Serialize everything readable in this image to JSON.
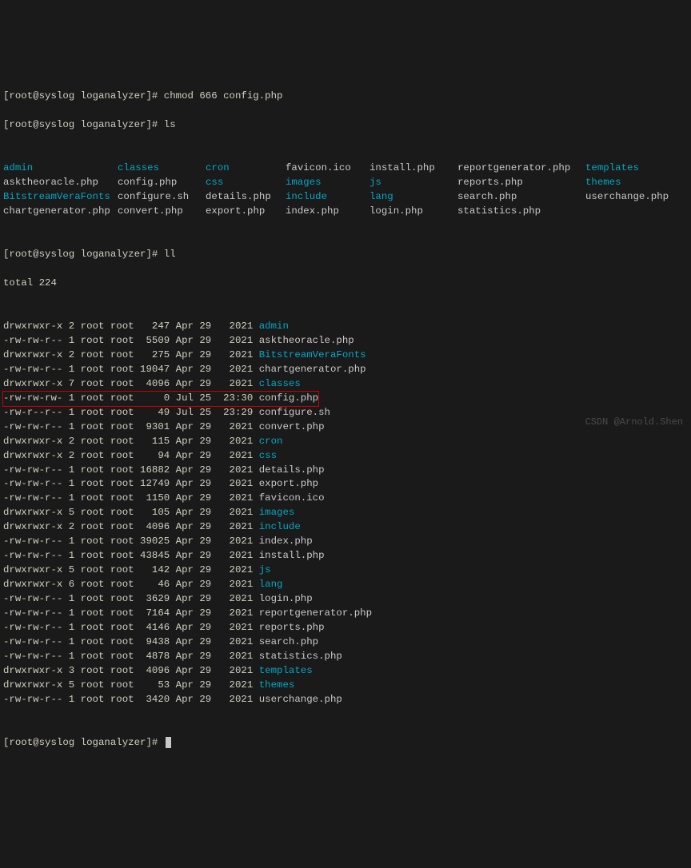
{
  "prompts": {
    "p1": "[root@syslog loganalyzer]# chmod 666 config.php",
    "p2": "[root@syslog loganalyzer]# ls",
    "p3": "[root@syslog loganalyzer]# ll",
    "p4": "[root@syslog loganalyzer]# "
  },
  "ls": {
    "row1": [
      "admin",
      "classes",
      "cron",
      "favicon.ico",
      "install.php",
      "reportgenerator.php",
      "templates"
    ],
    "row2": [
      "asktheoracle.php",
      "config.php",
      "css",
      "images",
      "js",
      "reports.php",
      "themes"
    ],
    "row3": [
      "BitstreamVeraFonts",
      "configure.sh",
      "details.php",
      "include",
      "lang",
      "search.php",
      "userchange.php"
    ],
    "row4": [
      "chartgenerator.php",
      "convert.php",
      "export.php",
      "index.php",
      "login.php",
      "statistics.php",
      ""
    ]
  },
  "ls_colors": {
    "row1": [
      "cyan",
      "cyan",
      "cyan",
      "gray",
      "gray",
      "gray",
      "cyan"
    ],
    "row2": [
      "gray",
      "gray",
      "cyan",
      "cyan",
      "cyan",
      "gray",
      "cyan"
    ],
    "row3": [
      "cyan",
      "gray",
      "gray",
      "cyan",
      "cyan",
      "gray",
      "gray"
    ],
    "row4": [
      "gray",
      "gray",
      "gray",
      "gray",
      "gray",
      "gray",
      "gray"
    ]
  },
  "total": "total 224",
  "ll": [
    {
      "perm": "drwxrwxr-x",
      "links": "2",
      "user": "root",
      "group": "root",
      "size": "247",
      "mon": "Apr",
      "day": "29",
      "time": "2021",
      "name": "admin",
      "cls": "cyan"
    },
    {
      "perm": "-rw-rw-r--",
      "links": "1",
      "user": "root",
      "group": "root",
      "size": "5509",
      "mon": "Apr",
      "day": "29",
      "time": "2021",
      "name": "asktheoracle.php",
      "cls": "gray"
    },
    {
      "perm": "drwxrwxr-x",
      "links": "2",
      "user": "root",
      "group": "root",
      "size": "275",
      "mon": "Apr",
      "day": "29",
      "time": "2021",
      "name": "BitstreamVeraFonts",
      "cls": "cyan"
    },
    {
      "perm": "-rw-rw-r--",
      "links": "1",
      "user": "root",
      "group": "root",
      "size": "19047",
      "mon": "Apr",
      "day": "29",
      "time": "2021",
      "name": "chartgenerator.php",
      "cls": "gray"
    },
    {
      "perm": "drwxrwxr-x",
      "links": "7",
      "user": "root",
      "group": "root",
      "size": "4096",
      "mon": "Apr",
      "day": "29",
      "time": "2021",
      "name": "classes",
      "cls": "cyan"
    },
    {
      "perm": "-rw-rw-rw-",
      "links": "1",
      "user": "root",
      "group": "root",
      "size": "0",
      "mon": "Jul",
      "day": "25",
      "time": "23:30",
      "name": "config.php",
      "cls": "gray",
      "highlight": true
    },
    {
      "perm": "-rw-r--r--",
      "links": "1",
      "user": "root",
      "group": "root",
      "size": "49",
      "mon": "Jul",
      "day": "25",
      "time": "23:29",
      "name": "configure.sh",
      "cls": "gray"
    },
    {
      "perm": "-rw-rw-r--",
      "links": "1",
      "user": "root",
      "group": "root",
      "size": "9301",
      "mon": "Apr",
      "day": "29",
      "time": "2021",
      "name": "convert.php",
      "cls": "gray"
    },
    {
      "perm": "drwxrwxr-x",
      "links": "2",
      "user": "root",
      "group": "root",
      "size": "115",
      "mon": "Apr",
      "day": "29",
      "time": "2021",
      "name": "cron",
      "cls": "cyan"
    },
    {
      "perm": "drwxrwxr-x",
      "links": "2",
      "user": "root",
      "group": "root",
      "size": "94",
      "mon": "Apr",
      "day": "29",
      "time": "2021",
      "name": "css",
      "cls": "cyan"
    },
    {
      "perm": "-rw-rw-r--",
      "links": "1",
      "user": "root",
      "group": "root",
      "size": "16882",
      "mon": "Apr",
      "day": "29",
      "time": "2021",
      "name": "details.php",
      "cls": "gray"
    },
    {
      "perm": "-rw-rw-r--",
      "links": "1",
      "user": "root",
      "group": "root",
      "size": "12749",
      "mon": "Apr",
      "day": "29",
      "time": "2021",
      "name": "export.php",
      "cls": "gray"
    },
    {
      "perm": "-rw-rw-r--",
      "links": "1",
      "user": "root",
      "group": "root",
      "size": "1150",
      "mon": "Apr",
      "day": "29",
      "time": "2021",
      "name": "favicon.ico",
      "cls": "gray"
    },
    {
      "perm": "drwxrwxr-x",
      "links": "5",
      "user": "root",
      "group": "root",
      "size": "105",
      "mon": "Apr",
      "day": "29",
      "time": "2021",
      "name": "images",
      "cls": "cyan"
    },
    {
      "perm": "drwxrwxr-x",
      "links": "2",
      "user": "root",
      "group": "root",
      "size": "4096",
      "mon": "Apr",
      "day": "29",
      "time": "2021",
      "name": "include",
      "cls": "cyan"
    },
    {
      "perm": "-rw-rw-r--",
      "links": "1",
      "user": "root",
      "group": "root",
      "size": "39025",
      "mon": "Apr",
      "day": "29",
      "time": "2021",
      "name": "index.php",
      "cls": "gray"
    },
    {
      "perm": "-rw-rw-r--",
      "links": "1",
      "user": "root",
      "group": "root",
      "size": "43845",
      "mon": "Apr",
      "day": "29",
      "time": "2021",
      "name": "install.php",
      "cls": "gray"
    },
    {
      "perm": "drwxrwxr-x",
      "links": "5",
      "user": "root",
      "group": "root",
      "size": "142",
      "mon": "Apr",
      "day": "29",
      "time": "2021",
      "name": "js",
      "cls": "cyan"
    },
    {
      "perm": "drwxrwxr-x",
      "links": "6",
      "user": "root",
      "group": "root",
      "size": "46",
      "mon": "Apr",
      "day": "29",
      "time": "2021",
      "name": "lang",
      "cls": "cyan"
    },
    {
      "perm": "-rw-rw-r--",
      "links": "1",
      "user": "root",
      "group": "root",
      "size": "3629",
      "mon": "Apr",
      "day": "29",
      "time": "2021",
      "name": "login.php",
      "cls": "gray"
    },
    {
      "perm": "-rw-rw-r--",
      "links": "1",
      "user": "root",
      "group": "root",
      "size": "7164",
      "mon": "Apr",
      "day": "29",
      "time": "2021",
      "name": "reportgenerator.php",
      "cls": "gray"
    },
    {
      "perm": "-rw-rw-r--",
      "links": "1",
      "user": "root",
      "group": "root",
      "size": "4146",
      "mon": "Apr",
      "day": "29",
      "time": "2021",
      "name": "reports.php",
      "cls": "gray"
    },
    {
      "perm": "-rw-rw-r--",
      "links": "1",
      "user": "root",
      "group": "root",
      "size": "9438",
      "mon": "Apr",
      "day": "29",
      "time": "2021",
      "name": "search.php",
      "cls": "gray"
    },
    {
      "perm": "-rw-rw-r--",
      "links": "1",
      "user": "root",
      "group": "root",
      "size": "4878",
      "mon": "Apr",
      "day": "29",
      "time": "2021",
      "name": "statistics.php",
      "cls": "gray"
    },
    {
      "perm": "drwxrwxr-x",
      "links": "3",
      "user": "root",
      "group": "root",
      "size": "4096",
      "mon": "Apr",
      "day": "29",
      "time": "2021",
      "name": "templates",
      "cls": "cyan"
    },
    {
      "perm": "drwxrwxr-x",
      "links": "5",
      "user": "root",
      "group": "root",
      "size": "53",
      "mon": "Apr",
      "day": "29",
      "time": "2021",
      "name": "themes",
      "cls": "cyan"
    },
    {
      "perm": "-rw-rw-r--",
      "links": "1",
      "user": "root",
      "group": "root",
      "size": "3420",
      "mon": "Apr",
      "day": "29",
      "time": "2021",
      "name": "userchange.php",
      "cls": "gray"
    }
  ],
  "watermark": "CSDN @Arnold.Shen"
}
